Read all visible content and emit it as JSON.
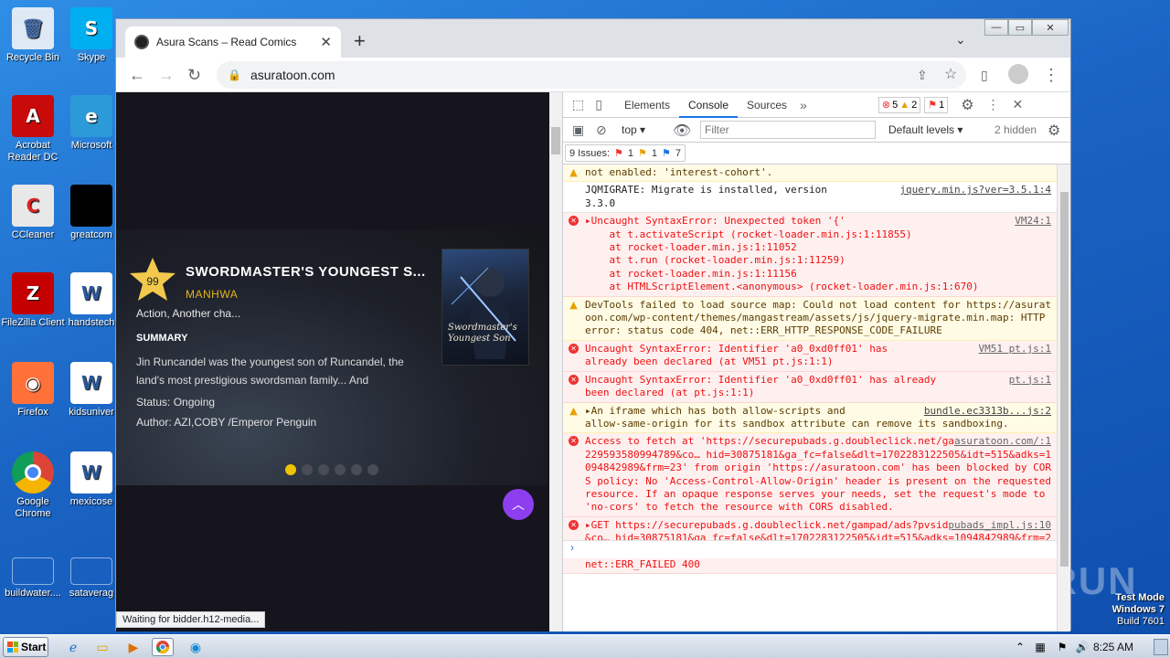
{
  "desktop": {
    "icons": [
      {
        "label": "Recycle Bin",
        "icon": "recycle-bin-icon"
      },
      {
        "label": "Skype",
        "icon": "skype-icon"
      },
      {
        "label": "Acrobat Reader DC",
        "icon": "acrobat-icon"
      },
      {
        "label": "Microsoft",
        "icon": "edge-icon"
      },
      {
        "label": "CCleaner",
        "icon": "ccleaner-icon"
      },
      {
        "label": "greatcom",
        "icon": "file-icon"
      },
      {
        "label": "FileZilla Client",
        "icon": "filezilla-icon"
      },
      {
        "label": "handstech",
        "icon": "word-doc-icon"
      },
      {
        "label": "Firefox",
        "icon": "firefox-icon"
      },
      {
        "label": "kidsuniver",
        "icon": "word-doc-icon"
      },
      {
        "label": "Google Chrome",
        "icon": "chrome-icon"
      },
      {
        "label": "mexicose",
        "icon": "word-doc-icon"
      },
      {
        "label": "buildwater....",
        "icon": "blank-file-icon"
      },
      {
        "label": "sataverag",
        "icon": "blank-file-icon"
      }
    ],
    "watermark": {
      "line1": "Test Mode",
      "line2": "Windows 7",
      "line3": "Build 7601"
    },
    "brand": "ANY RUN"
  },
  "browser": {
    "tab_title": "Asura Scans – Read Comics",
    "new_tab": "+",
    "url": "asuratoon.com",
    "status": "Waiting for bidder.h12-media...",
    "window_buttons": [
      "—",
      "▭",
      "✕"
    ]
  },
  "comic": {
    "rating": "99",
    "title": "SWORDMASTER'S YOUNGEST S...",
    "type": "MANHWA",
    "genres": "Action, Another cha...",
    "summary_heading": "SUMMARY",
    "summary": "Jin Runcandel was the youngest son of Runcandel, the land's most prestigious swordsman family... And",
    "status": "Status: Ongoing",
    "author": "Author: AZI,COBY /Emperor Penguin",
    "cover_text": "Swordmaster's Youngest Son",
    "slides": 6,
    "active_slide": 0
  },
  "devtools": {
    "tabs": [
      "Elements",
      "Console",
      "Sources"
    ],
    "active_tab": "Console",
    "error_count": "5",
    "warning_count": "2",
    "issue_count": "1",
    "context": "top",
    "filter_placeholder": "Filter",
    "levels": "Default levels",
    "hidden": "2 hidden",
    "issues_label": "9 Issues:",
    "issues_err": "1",
    "issues_warn": "1",
    "issues_info": "7",
    "messages": [
      {
        "kind": "warn",
        "text": "not enabled: 'interest-cohort'.",
        "src": ""
      },
      {
        "kind": "info",
        "text": "JQMIGRATE: Migrate is installed, version\n3.3.0",
        "src": "jquery.min.js?ver=3.5.1:4"
      },
      {
        "kind": "err",
        "text": "▸Uncaught SyntaxError: Unexpected token '{'\n    at t.activateScript (rocket-loader.min.js:1:11855)\n    at rocket-loader.min.js:1:11052\n    at t.run (rocket-loader.min.js:1:11259)\n    at rocket-loader.min.js:1:11156\n    at HTMLScriptElement.<anonymous> (rocket-loader.min.js:1:670)",
        "src": "VM24:1"
      },
      {
        "kind": "warn",
        "text": "DevTools failed to load source map: Could not load content for https://asuratoon.com/wp-content/themes/mangastream/assets/js/jquery-migrate.min.map: HTTP error: status code 404, net::ERR_HTTP_RESPONSE_CODE_FAILURE",
        "src": ""
      },
      {
        "kind": "err",
        "text": "Uncaught SyntaxError: Identifier 'a0_0xd0ff01' has\nalready been declared (at VM51 pt.js:1:1)",
        "src": "VM51 pt.js:1"
      },
      {
        "kind": "err",
        "text": "Uncaught SyntaxError: Identifier 'a0_0xd0ff01' has already\nbeen declared (at pt.js:1:1)",
        "src": "pt.js:1"
      },
      {
        "kind": "warn",
        "text": "▸An iframe which has both allow-scripts and\nallow-same-origin for its sandbox attribute can remove its sandboxing.",
        "src": "bundle.ec3313b...js:2"
      },
      {
        "kind": "err",
        "text": "Access to fetch at 'https://securepubads.g.doubleclick.net/gampad/ads?pvsid=2229593580994789&co… hid=30875181&ga_fc=false&dlt=1702283122505&idt=515&adks=1094842989&frm=23' from origin 'https://asuratoon.com' has been blocked by CORS policy: No 'Access-Control-Allow-Origin' header is present on the requested resource. If an opaque response serves your needs, set the request's mode to 'no-cors' to fetch the resource with CORS disabled.",
        "src": "asuratoon.com/:1"
      },
      {
        "kind": "err",
        "text": "▸GET https://securepubads.g.doubleclick.net/gampad/ads?pvsid=2229593580994789&co… hid=30875181&ga_fc=false&dlt=1702283122505&idt=515&adks=1094842989&frm=23\nnet::ERR_FAILED 400",
        "src": "pubads_impl.js:10"
      }
    ]
  },
  "taskbar": {
    "start_label": "Start",
    "clock": "8:25 AM"
  }
}
